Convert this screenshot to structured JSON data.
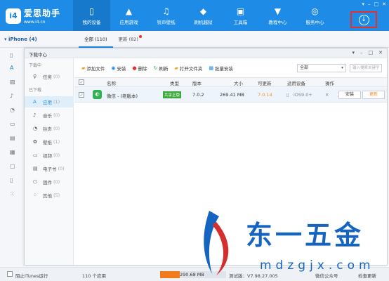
{
  "app": {
    "logo_badge": "i4",
    "logo_name": "爱思助手",
    "logo_url": "www.i4.cn"
  },
  "nav": [
    {
      "label": "我的设备",
      "icon": "phone-icon"
    },
    {
      "label": "应用游戏",
      "icon": "apps-icon"
    },
    {
      "label": "铃声壁纸",
      "icon": "music-icon"
    },
    {
      "label": "刷机越狱",
      "icon": "flash-icon"
    },
    {
      "label": "工具箱",
      "icon": "toolbox-icon"
    },
    {
      "label": "教程中心",
      "icon": "graduation-icon"
    },
    {
      "label": "服务中心",
      "icon": "compass-icon"
    }
  ],
  "window_controls": [
    "▾",
    "–",
    "□",
    "✕"
  ],
  "download_icon": "↓",
  "device": {
    "label": "iPhone (4)"
  },
  "subtabs": [
    {
      "label": "全部 (110)"
    },
    {
      "label": "更新 (82)"
    }
  ],
  "dialog": {
    "title": "下载中心",
    "controls": [
      "▾",
      "–",
      "□",
      "✕"
    ],
    "section_downloading": "下载中",
    "section_downloaded": "已下载",
    "task_item": {
      "label": "任务",
      "count": "(0)"
    },
    "items": [
      {
        "label": "应用",
        "count": "(1)",
        "icon": "app-icon"
      },
      {
        "label": "音乐",
        "count": "(0)",
        "icon": "music-icon"
      },
      {
        "label": "铃声",
        "count": "(0)",
        "icon": "bell-icon"
      },
      {
        "label": "壁纸",
        "count": "(1)",
        "icon": "wallpaper-icon"
      },
      {
        "label": "视频",
        "count": "(0)",
        "icon": "video-icon"
      },
      {
        "label": "电子书",
        "count": "(0)",
        "icon": "ebook-icon"
      },
      {
        "label": "固件",
        "count": "(0)",
        "icon": "firmware-icon"
      },
      {
        "label": "其他",
        "count": "(5)",
        "icon": "other-icon"
      }
    ],
    "toolbar": {
      "add_file": "添加文件",
      "install": "安装",
      "delete": "删除",
      "refresh": "刷新",
      "open_folder": "打开文件夹",
      "batch_install": "批量安装",
      "filter_value": "全部",
      "search_placeholder": "输入搜索关键字"
    },
    "columns": [
      "名称",
      "类型",
      "版本",
      "大小",
      "可更新",
      "适用设备",
      "操作"
    ],
    "rows": [
      {
        "name": "微信 - (老版本)",
        "type": "共享正版",
        "version": "7.0.2",
        "size": "269.41 MB",
        "update_version": "7.0.14",
        "device": "iOS9.0+",
        "install_label": "安装",
        "update_label": "更新"
      }
    ]
  },
  "bottom": {
    "itunes_label": "阻止iTunes运行",
    "app_count": "110 个应用",
    "storage_used": "290.68 MB",
    "storage_fraction": 0.3,
    "version_text": "测试版：V7.98.27.005",
    "wechat_public": "微信公众号",
    "check_update": "检查更新"
  },
  "watermark": {
    "text": "东一五金",
    "url": "mdzgjx.com"
  }
}
